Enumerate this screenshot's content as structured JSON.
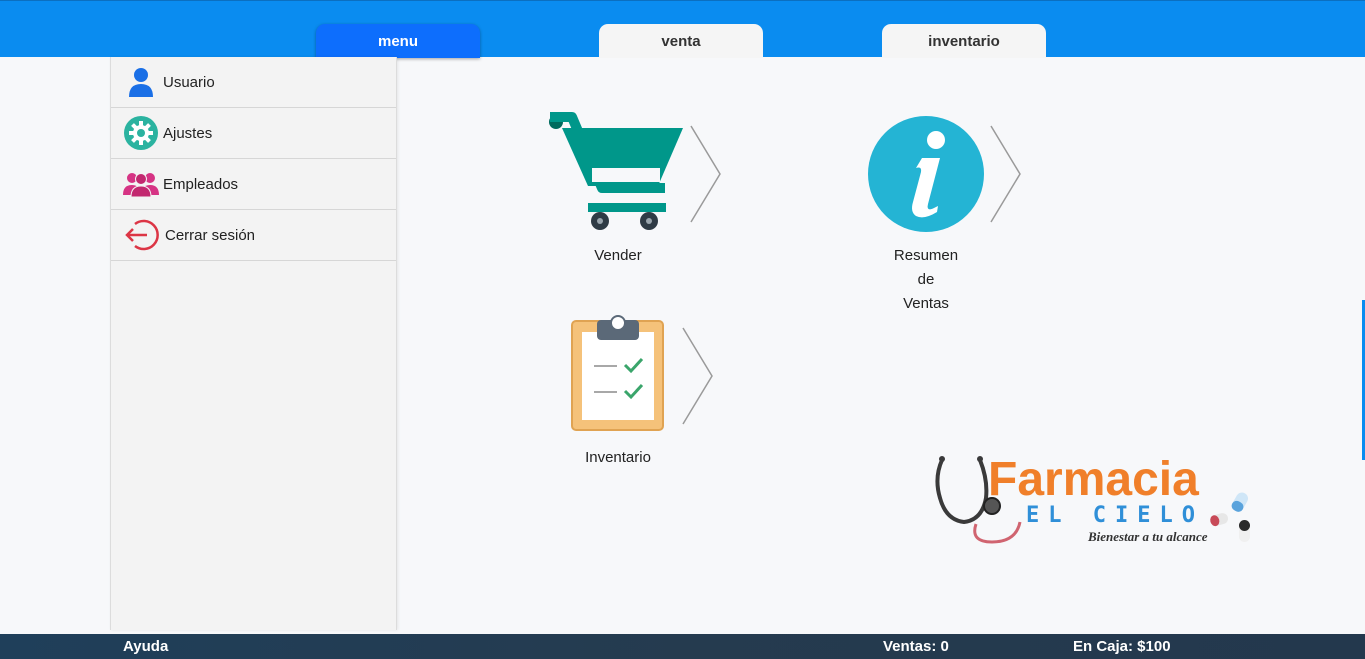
{
  "tabs": {
    "menu": "menu",
    "venta": "venta",
    "inventario": "inventario"
  },
  "sidebar": {
    "items": [
      {
        "label": "Usuario",
        "icon": "user-icon"
      },
      {
        "label": "Ajustes",
        "icon": "gear-icon"
      },
      {
        "label": "Empleados",
        "icon": "group-icon"
      },
      {
        "label": "Cerrar sesión",
        "icon": "logout-icon"
      }
    ]
  },
  "main": {
    "vender_label": "Vender",
    "resumen_label_1": "Resumen",
    "resumen_label_2": "de",
    "resumen_label_3": "Ventas",
    "inventario_label": "Inventario"
  },
  "logo": {
    "title": "Farmacia",
    "subtitle": "EL CIELO",
    "tagline": "Bienestar a tu alcance"
  },
  "footer": {
    "help": "Ayuda",
    "sales": "Ventas: 0",
    "cash": "En Caja: $100"
  },
  "colors": {
    "topbar": "#0a8cf0",
    "active_tab": "#0d6efd",
    "cart": "#00978a",
    "info": "#24b4d4",
    "logo_orange": "#f07f2a",
    "logo_blue": "#2f8fd8"
  }
}
